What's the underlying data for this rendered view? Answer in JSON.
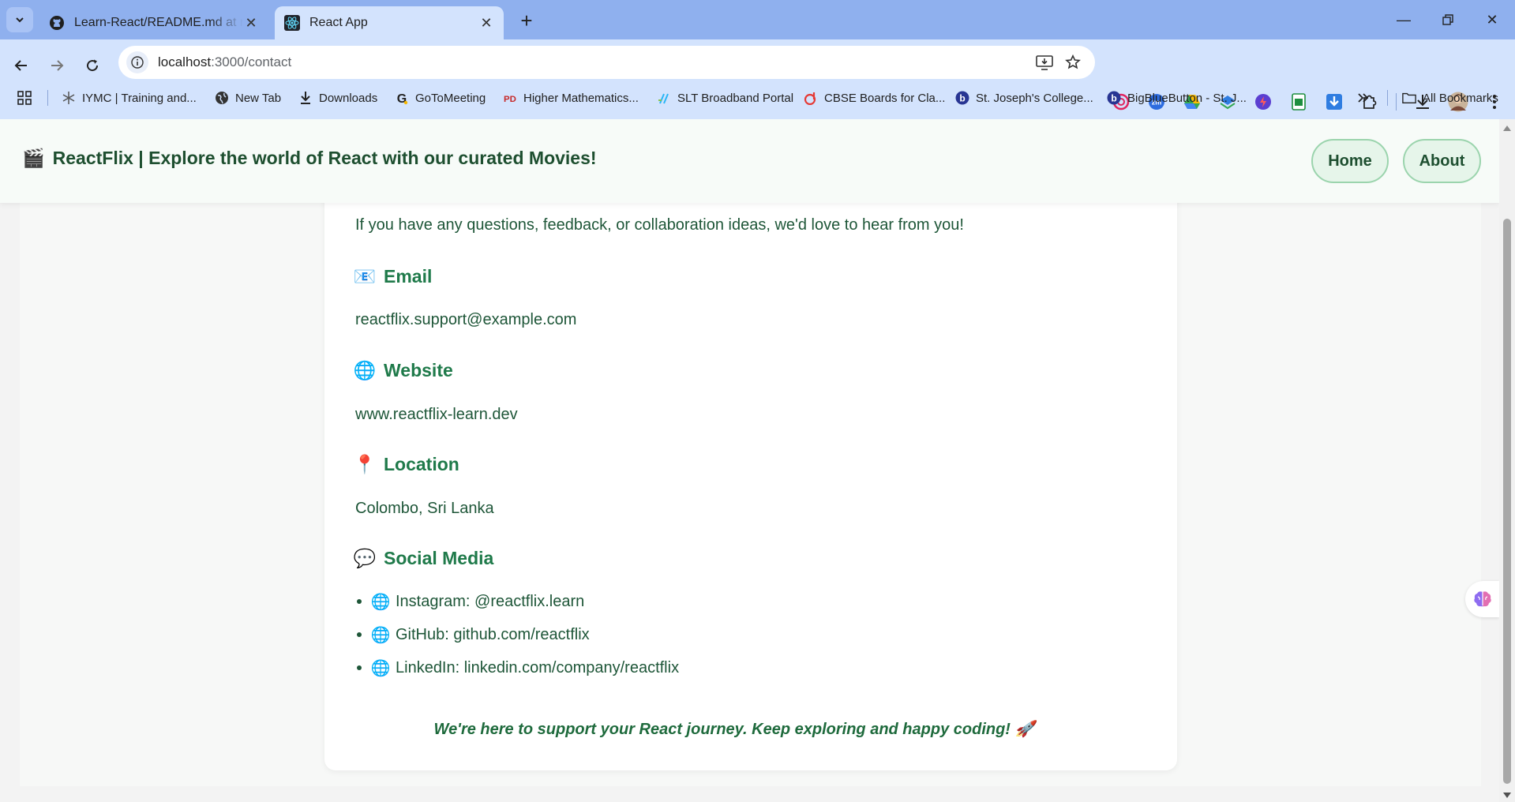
{
  "browser": {
    "tabs": [
      {
        "title": "Learn-React/README.md at main",
        "favicon": "github-icon",
        "active": false
      },
      {
        "title": "React App",
        "favicon": "react-icon",
        "active": true
      }
    ],
    "url_host": "localhost",
    "url_path": ":3000/contact",
    "bookmarks": [
      {
        "label": "IYMC | Training and...",
        "icon": "iymc-icon"
      },
      {
        "label": "New Tab",
        "icon": "globe-icon"
      },
      {
        "label": "Downloads",
        "icon": "download-icon"
      },
      {
        "label": "GoToMeeting",
        "icon": "gotomeeting-icon"
      },
      {
        "label": "Higher Mathematics...",
        "icon": "pdf-icon"
      },
      {
        "label": "SLT Broadband Portal",
        "icon": "slt-icon"
      },
      {
        "label": "CBSE Boards for Cla...",
        "icon": "cbse-icon"
      },
      {
        "label": "St. Joseph's College...",
        "icon": "bbb-icon"
      },
      {
        "label": "BigBlueButton - St. J...",
        "icon": "bbb-icon"
      }
    ],
    "all_bookmarks": "All Bookmarks"
  },
  "site": {
    "brand_emoji": "🎬",
    "brand_text": "ReactFlix | Explore the world of React with our curated Movies!",
    "nav": [
      {
        "label": "Home"
      },
      {
        "label": "About"
      }
    ]
  },
  "contact": {
    "intro": "If you have any questions, feedback, or collaboration ideas, we'd love to hear from you!",
    "email": {
      "emoji": "📧",
      "heading": "Email",
      "value": "reactflix.support@example.com"
    },
    "website": {
      "emoji": "🌐",
      "heading": "Website",
      "value": "www.reactflix-learn.dev"
    },
    "location": {
      "emoji": "📍",
      "heading": "Location",
      "value": "Colombo, Sri Lanka"
    },
    "social": {
      "emoji": "💬",
      "heading": "Social Media",
      "items": [
        {
          "emoji": "🌐",
          "text": "Instagram: @reactflix.learn"
        },
        {
          "emoji": "🌐",
          "text": "GitHub: github.com/reactflix"
        },
        {
          "emoji": "🌐",
          "text": "LinkedIn: linkedin.com/company/reactflix"
        }
      ]
    },
    "closing": "We're here to support your React journey. Keep exploring and happy coding! 🚀"
  },
  "colors": {
    "brand_green": "#1e4f30",
    "heading_green": "#1f7a4a",
    "chrome_blue": "#8fb0ee",
    "toolbar_blue": "#d3e3fd"
  }
}
